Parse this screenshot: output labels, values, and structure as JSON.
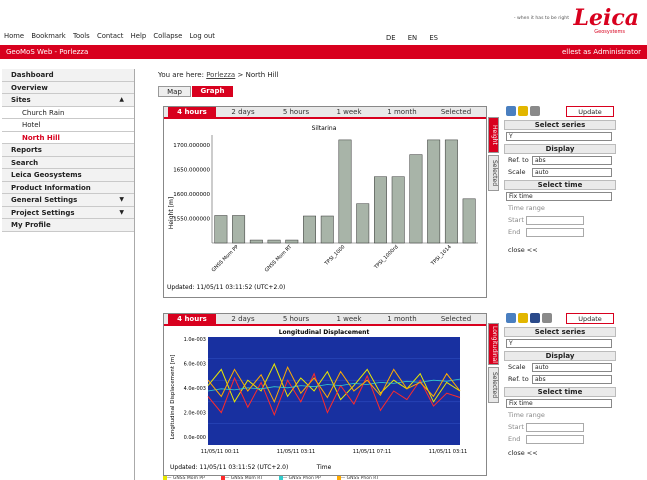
{
  "header": {
    "menu": [
      "Home",
      "Bookmark",
      "Tools",
      "Contact",
      "Help",
      "Collapse",
      "Log out"
    ],
    "languages": [
      "DE",
      "EN",
      "ES"
    ],
    "app_title": "GeoMoS Web - Porlezza",
    "user_text": "ellest as Administrator",
    "logo": "Leica",
    "logo_sub": "Geosystems",
    "tagline": "- when it has to be right"
  },
  "sidebar": {
    "items": [
      {
        "label": "Dashboard",
        "arrow": ""
      },
      {
        "label": "Overview",
        "arrow": ""
      },
      {
        "label": "Sites",
        "arrow": "▲"
      },
      {
        "label": "Church Rain",
        "arrow": ""
      },
      {
        "label": "Hotel",
        "arrow": ""
      },
      {
        "label": "North Hill",
        "arrow": ""
      },
      {
        "label": "Reports",
        "arrow": ""
      },
      {
        "label": "Search",
        "arrow": ""
      },
      {
        "label": "Leica Geosystems",
        "arrow": ""
      },
      {
        "label": "Product Information",
        "arrow": ""
      },
      {
        "label": "General Settings",
        "arrow": "▼"
      },
      {
        "label": "Project Settings",
        "arrow": "▼"
      },
      {
        "label": "My Profile",
        "arrow": ""
      }
    ]
  },
  "breadcrumb": {
    "prefix": "You are here:",
    "link": "Porlezza",
    "sep": ">",
    "current": "North Hill"
  },
  "view_tabs": {
    "map": "Map",
    "graph": "Graph"
  },
  "time_tabs": [
    "4 hours",
    "2 days",
    "5 hours",
    "1 week",
    "1 month",
    "Selected"
  ],
  "time_tabs_2": [
    "4 hours",
    "2 days",
    "5 hours",
    "1 week",
    "1 month",
    "Selected"
  ],
  "panel1": {
    "side_tabs": [
      "Height",
      "Selected"
    ],
    "updated": "Updated: 11/05/11 03:11:52 (UTC+2.0)"
  },
  "panel2": {
    "side_tabs": [
      "Longitudinal",
      "Selected"
    ],
    "updated": "Updated: 11/05/11 03:11:52 (UTC+2.0)"
  },
  "controls1": {
    "update": "Update",
    "select_series": "Select series",
    "series_value": "Y",
    "display": "Display",
    "ref_label": "Ref. to",
    "ref_value": "abs",
    "scale_label": "Scale",
    "scale_value": "auto",
    "select_time": "Select time",
    "fix_time": "Fix time",
    "time_range": "Time range",
    "start": "Start",
    "end": "End",
    "close": "close <<"
  },
  "controls2": {
    "update": "Update",
    "select_series": "Select series",
    "series_value": "Y",
    "display": "Display",
    "scale_label": "Scale",
    "scale_value": "auto",
    "ref_label": "Ref. to",
    "ref_value": "abs",
    "select_time": "Select time",
    "fix_time": "Fix time",
    "time_range": "Time range",
    "start": "Start",
    "end": "End",
    "close": "close <<"
  },
  "colors": {
    "accent": "#d8001e",
    "bar": "#9aa89a",
    "plot_bg": "#1830a0"
  },
  "chart_data": [
    {
      "type": "bar",
      "title": "Siltarina",
      "ylabel": "Height [m]",
      "yticks": [
        "1700.000000",
        "1650.000000",
        "1600.000000",
        "1550.000000"
      ],
      "ylim": [
        1500,
        1720
      ],
      "categories": [
        "GNSS Mom PP",
        "GNSS Mom RT",
        "TPSI_1000",
        "TPSI_1000rd",
        "TPSI_1014"
      ],
      "values": [
        1556,
        1556,
        1506,
        1506,
        1506,
        1555,
        1555,
        1710,
        1580,
        1635,
        1635,
        1680,
        1710,
        1710,
        1590
      ]
    },
    {
      "type": "line",
      "title": "Longitudinal Displacement",
      "ylabel": "Longitudinal Displacement [m]",
      "xlabel": "Time",
      "yticks": [
        "1.0e-003",
        "6.0e-003",
        "4.0e-003",
        "2.0e-003",
        "0.0e-000"
      ],
      "xticks": [
        "11/05/11 00:11",
        "11/05/11 03:11",
        "11/05/11 07:11",
        "11/05/11 03:11"
      ],
      "legend": [
        "GNSS Mom PP",
        "GNSS Mom RT",
        "GNSS Phon PP",
        "GNSS Phon RT"
      ],
      "series": [
        {
          "name": "GNSS Mom PP",
          "values": [
            0.55,
            0.7,
            0.4,
            0.6,
            0.5,
            0.75,
            0.45,
            0.62,
            0.5,
            0.68,
            0.42,
            0.55,
            0.7,
            0.48,
            0.6,
            0.52,
            0.66,
            0.4,
            0.58,
            0.5
          ]
        },
        {
          "name": "GNSS Mom RT",
          "values": [
            0.45,
            0.3,
            0.62,
            0.35,
            0.58,
            0.28,
            0.6,
            0.4,
            0.66,
            0.3,
            0.55,
            0.38,
            0.64,
            0.32,
            0.5,
            0.42,
            0.6,
            0.36,
            0.48,
            0.44
          ]
        },
        {
          "name": "GNSS Phon PP",
          "values": [
            0.5,
            0.52,
            0.51,
            0.53,
            0.52,
            0.54,
            0.53,
            0.55,
            0.54,
            0.56,
            0.55,
            0.57,
            0.56,
            0.58,
            0.57,
            0.59,
            0.58,
            0.6,
            0.59,
            0.61
          ]
        },
        {
          "name": "GNSS Phon RT",
          "values": [
            0.6,
            0.45,
            0.7,
            0.5,
            0.65,
            0.4,
            0.72,
            0.48,
            0.62,
            0.44,
            0.68,
            0.5,
            0.6,
            0.46,
            0.7,
            0.52,
            0.58,
            0.45,
            0.66,
            0.5
          ]
        }
      ]
    }
  ]
}
